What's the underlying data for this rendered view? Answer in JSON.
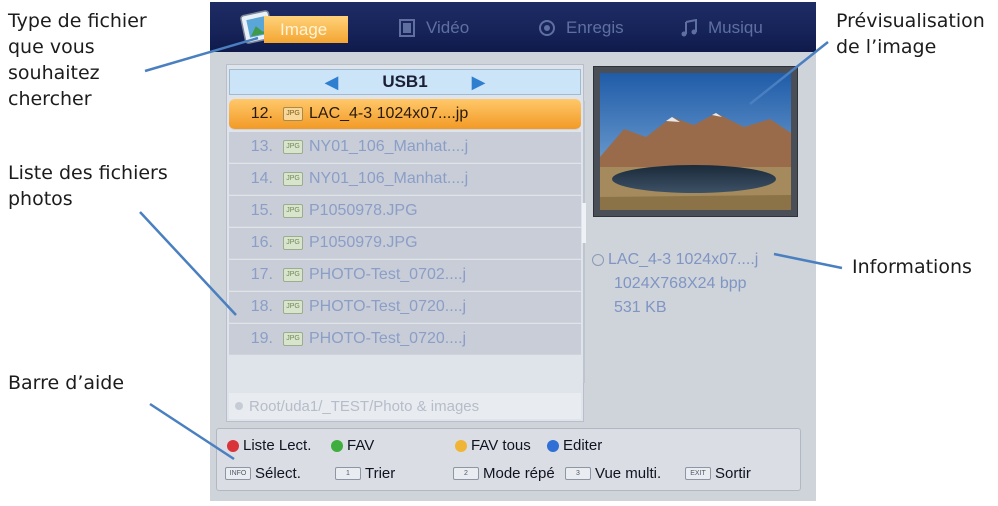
{
  "annotations": {
    "file_type_line1": "Type de fichier",
    "file_type_line2": "que vous",
    "file_type_line3": "souhaitez",
    "file_type_line4": "chercher",
    "list_line1": "Liste des fichiers",
    "list_line2": "photos",
    "help_bar": "Barre d’aide",
    "preview_line1": "Prévisualisation",
    "preview_line2": "de l’image",
    "informations": "Informations"
  },
  "tabs": {
    "image": "Image",
    "video": "Vidéo",
    "record": "Enregis",
    "music": "Musiqu"
  },
  "device": {
    "name": "USB1",
    "prev_arrow": "◀",
    "next_arrow": "▶"
  },
  "files": [
    {
      "num": "12.",
      "name": "LAC_4-3 1024x07....jp",
      "selected": true
    },
    {
      "num": "13.",
      "name": "NY01_106_Manhat....j"
    },
    {
      "num": "14.",
      "name": "NY01_106_Manhat....j"
    },
    {
      "num": "15.",
      "name": "P1050978.JPG"
    },
    {
      "num": "16.",
      "name": "P1050979.JPG"
    },
    {
      "num": "17.",
      "name": "PHOTO-Test_0702....j"
    },
    {
      "num": "18.",
      "name": "PHOTO-Test_0720....j"
    },
    {
      "num": "19.",
      "name": "PHOTO-Test_0720....j"
    }
  ],
  "jpg_badge": "JPG",
  "path": "Root/uda1/_TEST/Photo & images",
  "info": {
    "filename": "LAC_4-3 1024x07....j",
    "resolution": "1024X768X24 bpp",
    "size": "531 KB"
  },
  "help": {
    "red": "Liste Lect.",
    "green": "FAV",
    "yellow": "FAV tous",
    "blue": "Editer",
    "info_key": "INFO",
    "select": "Sélect.",
    "key1": "1",
    "sort": "Trier",
    "key2": "2",
    "repeat": "Mode répé",
    "key3": "3",
    "multi": "Vue multi.",
    "exit_key": "EXIT",
    "exit": "Sortir"
  },
  "colors": {
    "red": "#d9343a",
    "green": "#3fae3f",
    "yellow": "#f0b536",
    "blue": "#2f6fd6",
    "accent_orange": "#f4a531",
    "header_navy": "#162359",
    "leader_blue": "#4a7fc0"
  }
}
